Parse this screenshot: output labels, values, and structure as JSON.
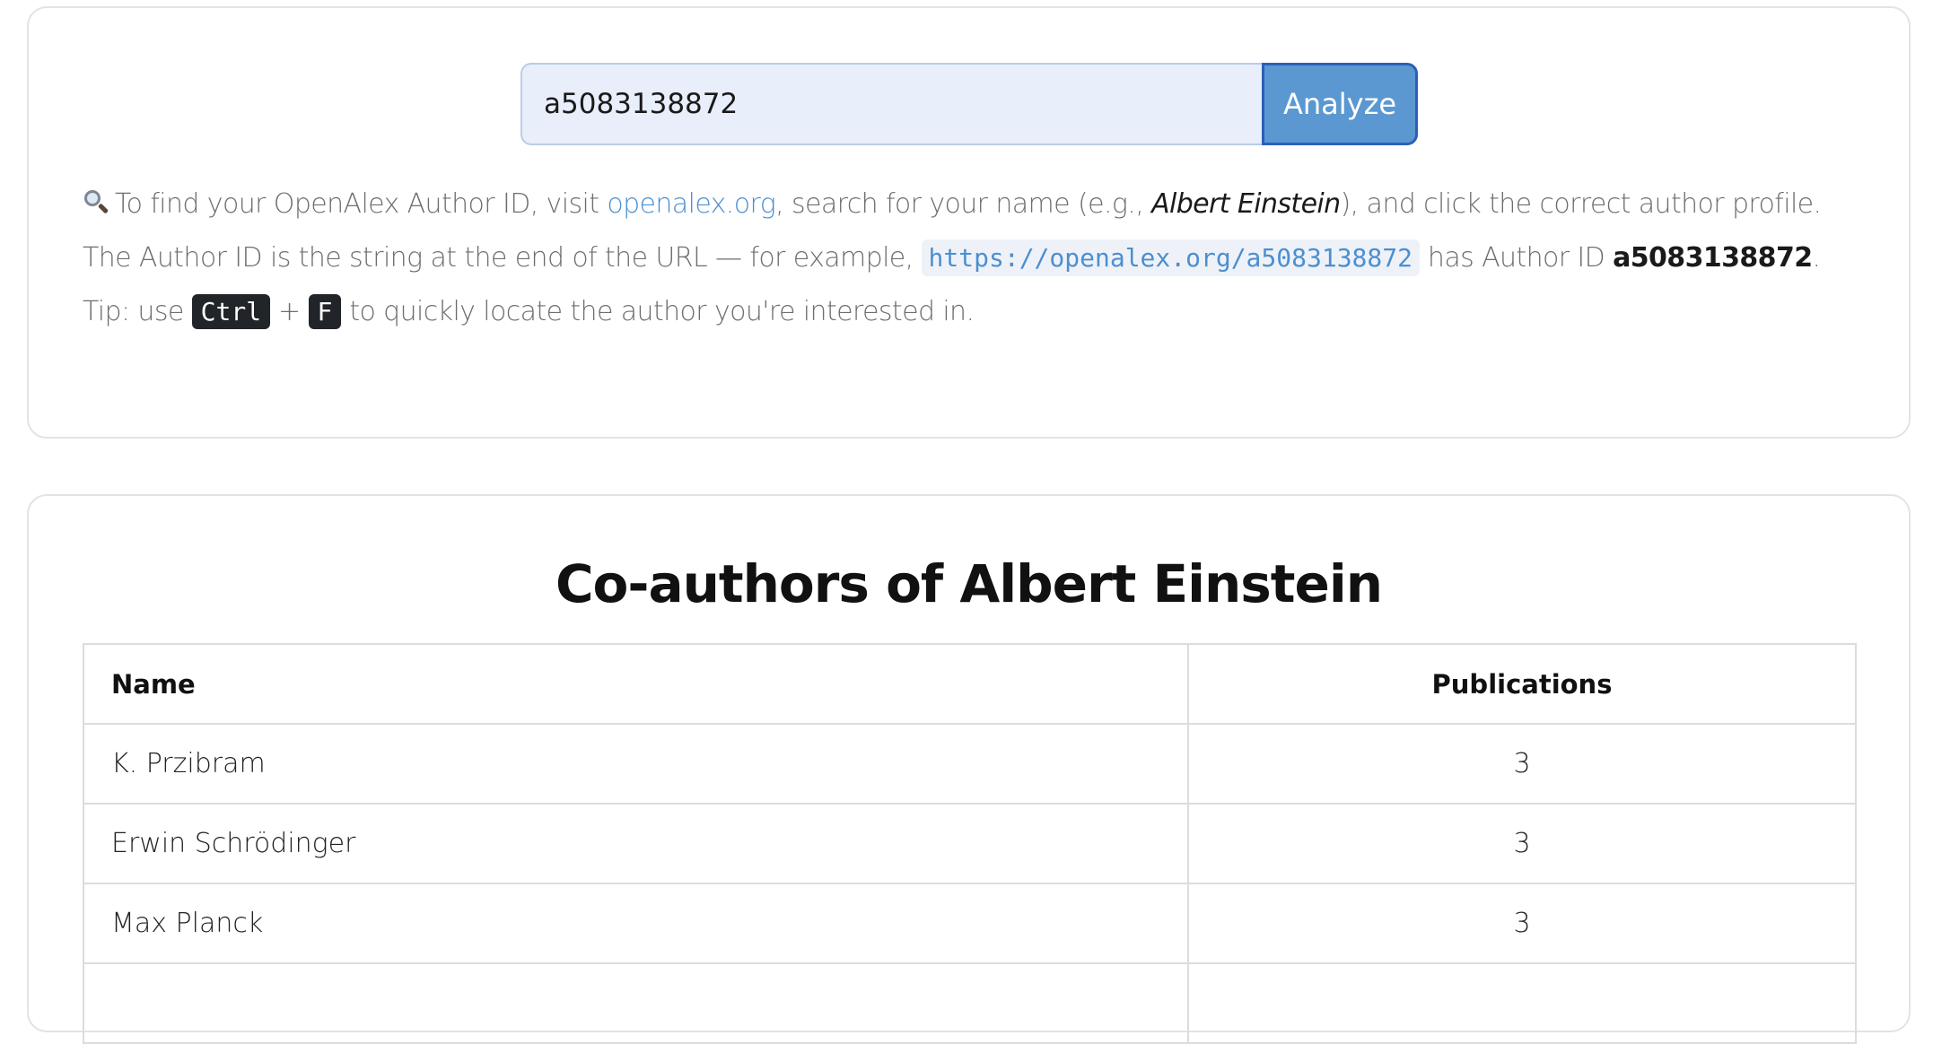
{
  "search": {
    "input_value": "a5083138872",
    "analyze_label": "Analyze"
  },
  "help": {
    "icon": "magnifying-glass-icon",
    "line1_prefix": "To find your OpenAlex Author ID, visit ",
    "link_text": "openalex.org",
    "line1_middle": ", search for your name (e.g., ",
    "example_name": "Albert Einstein",
    "line1_suffix": "), and click the correct author profile.",
    "line2_prefix": "The Author ID is the string at the end of the URL — for example, ",
    "example_url": "https://openalex.org/a5083138872",
    "line2_middle": " has Author ID ",
    "example_id": "a5083138872",
    "line2_suffix": ".",
    "tip_prefix": "Tip: use ",
    "key_ctrl": "Ctrl",
    "plus": " + ",
    "key_f": "F",
    "tip_suffix": " to quickly locate the author you're interested in."
  },
  "results": {
    "title": "Co-authors of Albert Einstein",
    "columns": {
      "name": "Name",
      "publications": "Publications"
    },
    "rows": [
      {
        "name": "K. Przibram",
        "publications": "3"
      },
      {
        "name": "Erwin Schrödinger",
        "publications": "3"
      },
      {
        "name": "Max Planck",
        "publications": "3"
      },
      {
        "name": "",
        "publications": ""
      }
    ]
  },
  "colors": {
    "accent": "#5b98d1",
    "link": "#4c8fd0",
    "input_bg": "#e8eefa"
  }
}
